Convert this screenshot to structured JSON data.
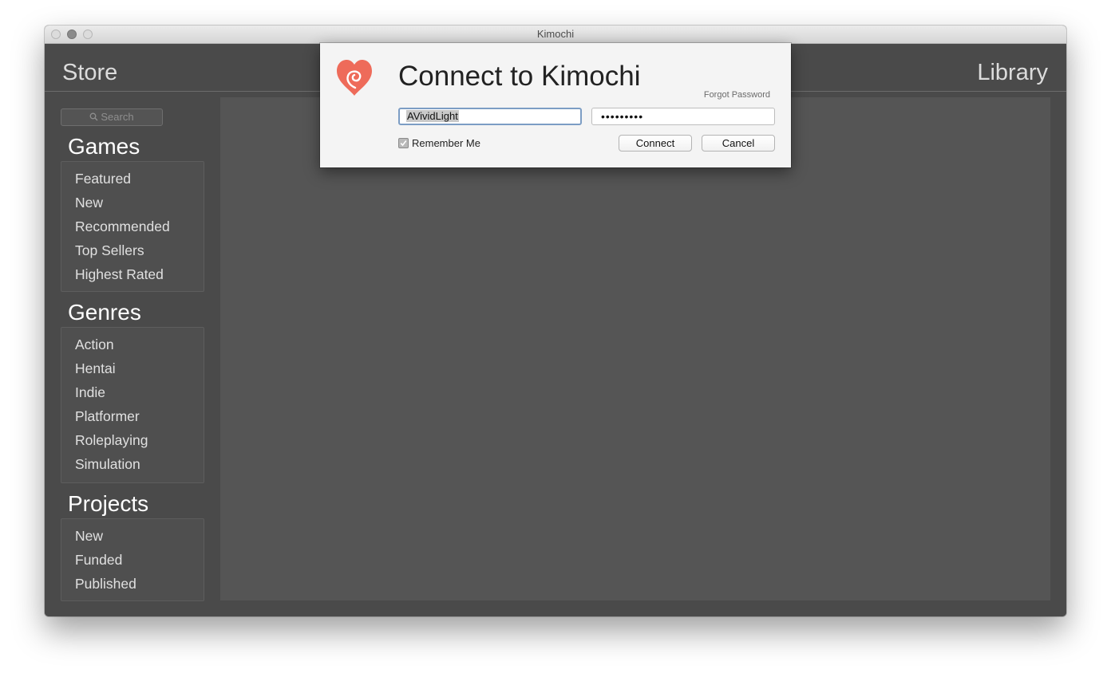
{
  "window": {
    "title": "Kimochi"
  },
  "header": {
    "store_label": "Store",
    "library_label": "Library"
  },
  "sidebar": {
    "search_placeholder": "Search",
    "sections": [
      {
        "title": "Games",
        "items": [
          "Featured",
          "New",
          "Recommended",
          "Top Sellers",
          "Highest Rated"
        ]
      },
      {
        "title": "Genres",
        "items": [
          "Action",
          "Hentai",
          "Indie",
          "Platformer",
          "Roleplaying",
          "Simulation"
        ]
      },
      {
        "title": "Projects",
        "items": [
          "New",
          "Funded",
          "Published"
        ]
      }
    ]
  },
  "dialog": {
    "title": "Connect to Kimochi",
    "forgot_password": "Forgot Password",
    "username_value": "AVividLight",
    "password_value": "•••••••••",
    "remember_label": "Remember Me",
    "remember_checked": true,
    "connect_label": "Connect",
    "cancel_label": "Cancel",
    "logo_icon": "heart-swirl-icon",
    "logo_color": "#ee6b5a"
  }
}
